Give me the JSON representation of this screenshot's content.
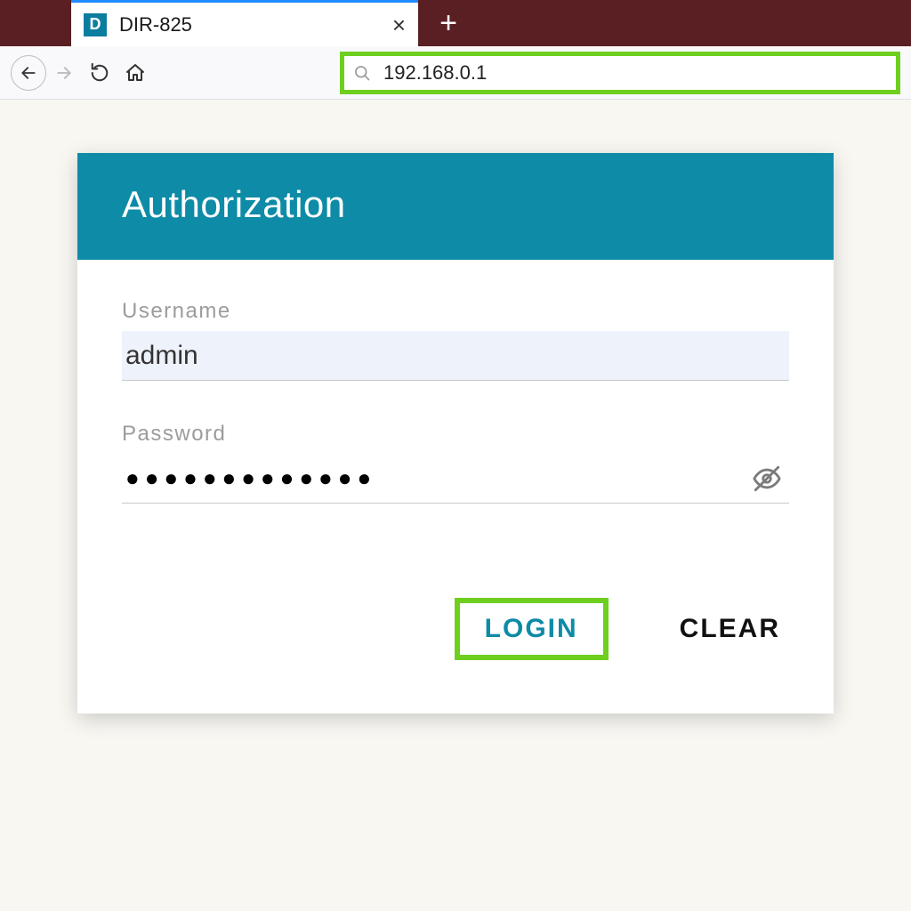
{
  "browser": {
    "tab": {
      "favicon_letter": "D",
      "title": "DIR-825"
    },
    "address": "192.168.0.1"
  },
  "card": {
    "title": "Authorization",
    "username_label": "Username",
    "username_value": "admin",
    "password_label": "Password",
    "password_masked": "●●●●●●●●●●●●●",
    "login_label": "LOGIN",
    "clear_label": "CLEAR"
  },
  "colors": {
    "accent_teal": "#0e8ba6",
    "highlight_green": "#6ecf1f",
    "tab_bar": "#5a1f22"
  }
}
